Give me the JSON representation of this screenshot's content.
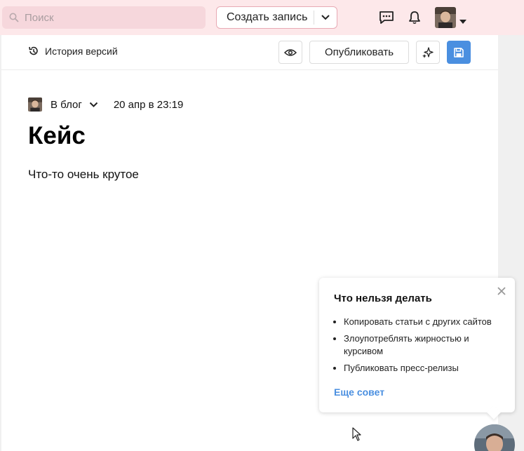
{
  "header": {
    "search_placeholder": "Поиск",
    "create_label": "Создать запись"
  },
  "toolbar": {
    "history_label": "История версий",
    "publish_label": "Опубликовать"
  },
  "post": {
    "blog_label": "В блог",
    "date": "20 апр в 23:19",
    "title": "Кейс",
    "body": "Что-то очень крутое"
  },
  "tips": {
    "title": "Что нельзя делать",
    "items": [
      "Копировать статьи с других сайтов",
      "Злоупотреблять жирностью и курсивом",
      "Публиковать пресс-релизы"
    ],
    "more_label": "Еще совет"
  },
  "colors": {
    "header_bg": "#fde8ea",
    "accent": "#4a8fe0",
    "create_border": "#e8aab4"
  },
  "icons": [
    "search-icon",
    "chevron-down-icon",
    "chat-icon",
    "bell-icon",
    "history-icon",
    "eye-icon",
    "sparkles-icon",
    "save-icon",
    "close-icon"
  ]
}
